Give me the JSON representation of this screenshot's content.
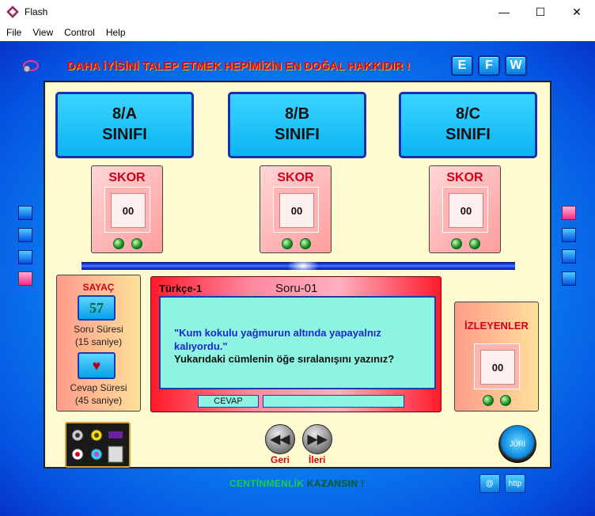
{
  "window": {
    "title": "Flash",
    "minimize": "—",
    "maximize": "☐",
    "close": "✕"
  },
  "menu": [
    "File",
    "View",
    "Control",
    "Help"
  ],
  "motto": "DAHA İYİSİNİ TALEP ETMEK HEPİMİZİN EN DOĞAL HAKKIDIR !",
  "lang_buttons": [
    "E",
    "F",
    "W"
  ],
  "classes": [
    {
      "line1": "8/A",
      "line2": "SINIFI",
      "score_label": "SKOR",
      "score": "00"
    },
    {
      "line1": "8/B",
      "line2": "SINIFI",
      "score_label": "SKOR",
      "score": "00"
    },
    {
      "line1": "8/C",
      "line2": "SINIFI",
      "score_label": "SKOR",
      "score": "00"
    }
  ],
  "timer": {
    "title": "SAYAÇ",
    "value": "57",
    "question_time_label": "Soru Süresi",
    "question_time_value": "(15 saniye)",
    "answer_time_label": "Cevap Süresi",
    "answer_time_value": "(45 saniye)",
    "heart": "♥"
  },
  "question": {
    "subject": "Türkçe-1",
    "number": "Soru-01",
    "quote": "\"Kum kokulu yağmurun altında yapayalnız kalıyordu.\"",
    "prompt": "Yukarıdaki cümlenin öğe sıralanışını yazınız?",
    "answer_label": "CEVAP",
    "answer_value": ""
  },
  "viewers": {
    "title": "İZLEYENLER",
    "score": "00"
  },
  "nav": {
    "back_glyph": "◀◀",
    "back_label": "Geri",
    "next_glyph": "▶▶",
    "next_label": "İleri"
  },
  "jury_label": "JÜRİ",
  "footer": {
    "part1": "CENTİNMENLİK",
    "part2": " KAZANSIN !"
  },
  "small_buttons": [
    "@",
    "http"
  ],
  "colors": {
    "accent_blue": "#0a7bf0",
    "panel_bg": "#fffbd0",
    "alert_red": "#e00010"
  }
}
